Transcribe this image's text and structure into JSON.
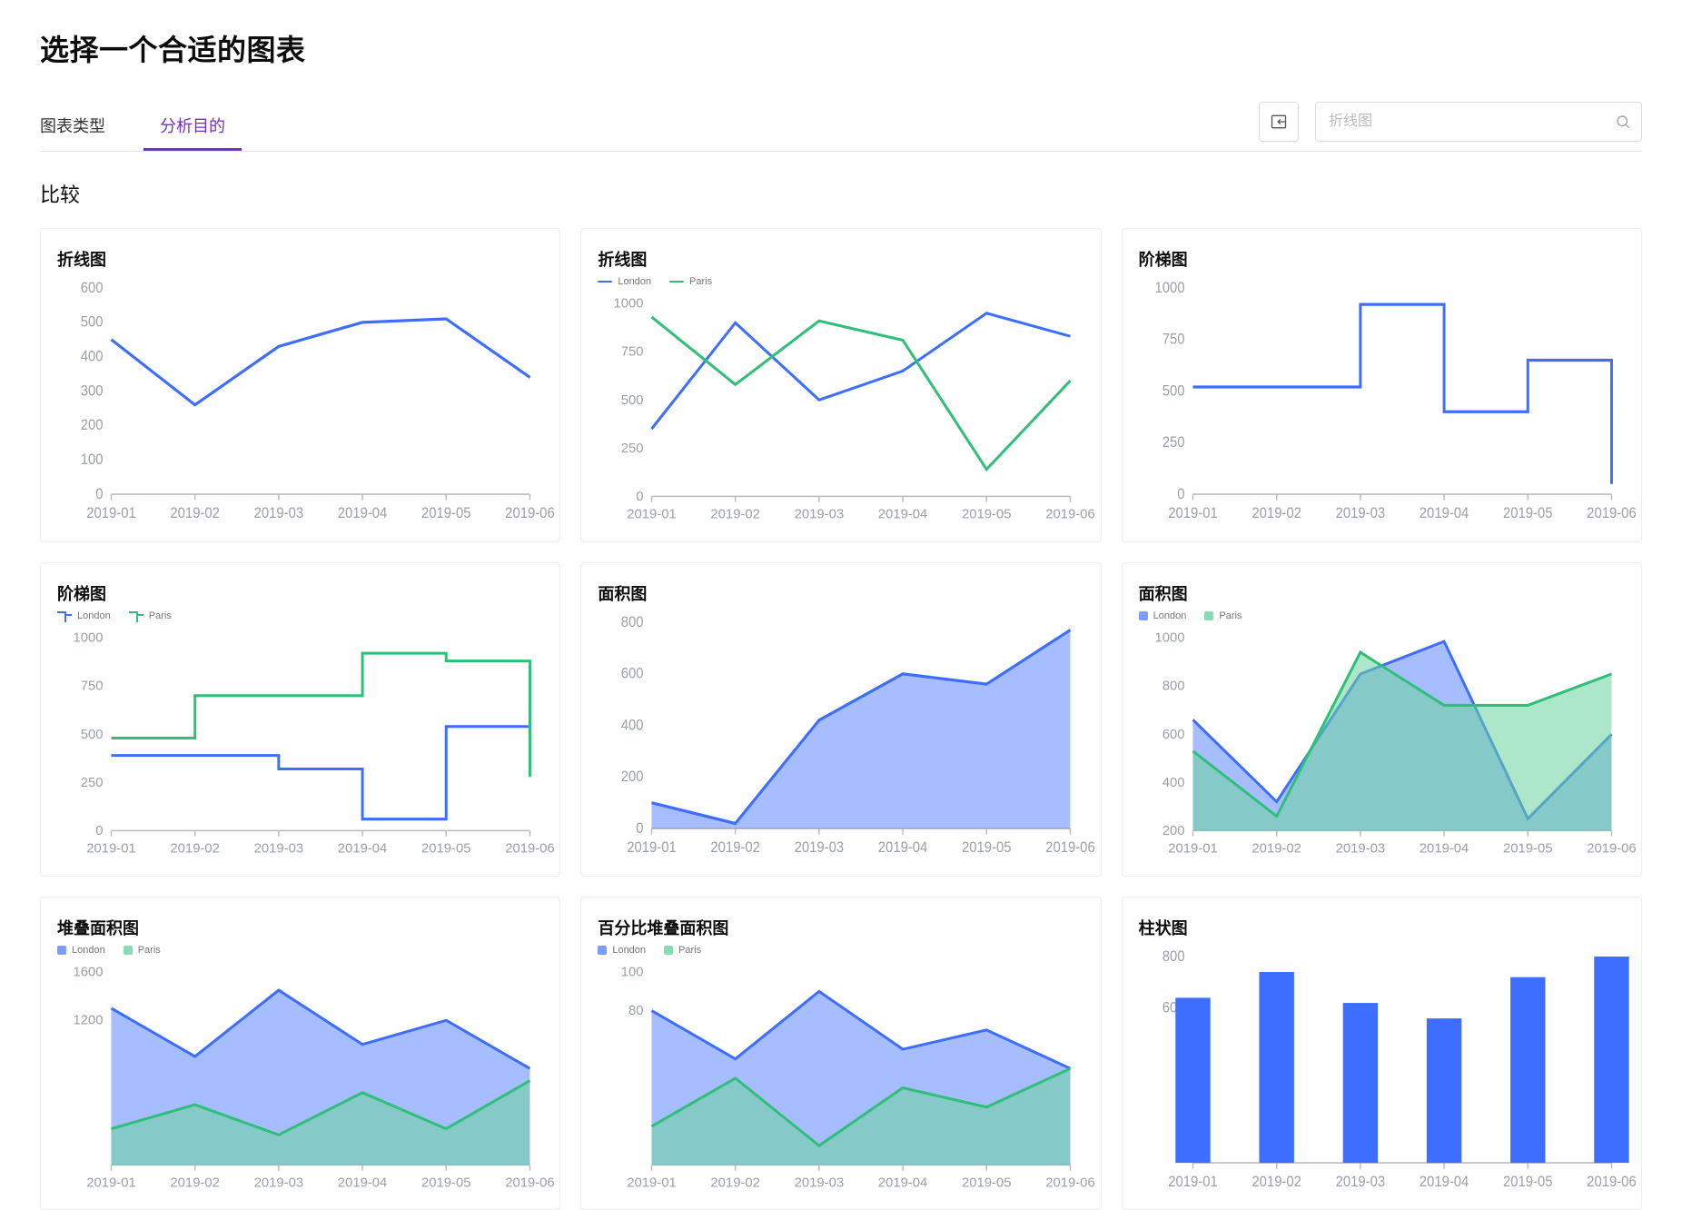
{
  "page": {
    "title": "选择一个合适的图表"
  },
  "toolbar": {
    "tabs": [
      {
        "label": "图表类型",
        "active": false
      },
      {
        "label": "分析目的",
        "active": true
      }
    ],
    "search_placeholder": "折线图"
  },
  "section": {
    "title": "比较"
  },
  "colors": {
    "blue": "#3d6eff",
    "green": "#30bf78",
    "blueFill": "rgba(93,134,255,0.55)",
    "greenFill": "rgba(106,211,157,0.55)"
  },
  "legend_labels": {
    "london": "London",
    "paris": "Paris"
  },
  "cards": [
    {
      "id": "line1",
      "title": "折线图"
    },
    {
      "id": "line2",
      "title": "折线图"
    },
    {
      "id": "step1",
      "title": "阶梯图"
    },
    {
      "id": "step2",
      "title": "阶梯图"
    },
    {
      "id": "area1",
      "title": "面积图"
    },
    {
      "id": "area2",
      "title": "面积图"
    },
    {
      "id": "stack1",
      "title": "堆叠面积图"
    },
    {
      "id": "pct1",
      "title": "百分比堆叠面积图"
    },
    {
      "id": "bar1",
      "title": "柱状图"
    }
  ],
  "chart_data": [
    {
      "id": "line1",
      "type": "line",
      "title": "折线图",
      "categories": [
        "2019-01",
        "2019-02",
        "2019-03",
        "2019-04",
        "2019-05",
        "2019-06"
      ],
      "series": [
        {
          "name": "",
          "values": [
            450,
            260,
            430,
            500,
            510,
            340
          ]
        }
      ],
      "ylim": [
        0,
        600
      ],
      "yticks": [
        0,
        100,
        200,
        300,
        400,
        500,
        600
      ]
    },
    {
      "id": "line2",
      "type": "line",
      "title": "折线图",
      "categories": [
        "2019-01",
        "2019-02",
        "2019-03",
        "2019-04",
        "2019-05",
        "2019-06"
      ],
      "series": [
        {
          "name": "London",
          "values": [
            350,
            900,
            500,
            650,
            950,
            830
          ]
        },
        {
          "name": "Paris",
          "values": [
            930,
            580,
            910,
            810,
            140,
            600
          ]
        }
      ],
      "ylim": [
        0,
        1000
      ],
      "yticks": [
        0,
        250,
        500,
        750,
        1000
      ]
    },
    {
      "id": "step1",
      "type": "step",
      "title": "阶梯图",
      "categories": [
        "2019-01",
        "2019-02",
        "2019-03",
        "2019-04",
        "2019-05",
        "2019-06"
      ],
      "series": [
        {
          "name": "",
          "values": [
            520,
            520,
            920,
            400,
            650,
            50
          ]
        }
      ],
      "ylim": [
        0,
        1000
      ],
      "yticks": [
        0,
        250,
        500,
        750,
        1000
      ]
    },
    {
      "id": "step2",
      "type": "step",
      "title": "阶梯图",
      "categories": [
        "2019-01",
        "2019-02",
        "2019-03",
        "2019-04",
        "2019-05",
        "2019-06"
      ],
      "series": [
        {
          "name": "London",
          "values": [
            390,
            390,
            320,
            60,
            540,
            650
          ]
        },
        {
          "name": "Paris",
          "values": [
            480,
            700,
            700,
            920,
            880,
            280
          ]
        }
      ],
      "ylim": [
        0,
        1000
      ],
      "yticks": [
        0,
        250,
        500,
        750,
        1000
      ]
    },
    {
      "id": "area1",
      "type": "area",
      "title": "面积图",
      "categories": [
        "2019-01",
        "2019-02",
        "2019-03",
        "2019-04",
        "2019-05",
        "2019-06"
      ],
      "series": [
        {
          "name": "",
          "values": [
            100,
            20,
            420,
            600,
            560,
            770
          ]
        }
      ],
      "ylim": [
        0,
        800
      ],
      "yticks": [
        0,
        200,
        400,
        600,
        800
      ]
    },
    {
      "id": "area2",
      "type": "area",
      "title": "面积图",
      "categories": [
        "2019-01",
        "2019-02",
        "2019-03",
        "2019-04",
        "2019-05",
        "2019-06"
      ],
      "series": [
        {
          "name": "London",
          "values": [
            660,
            320,
            850,
            985,
            250,
            600
          ]
        },
        {
          "name": "Paris",
          "values": [
            530,
            260,
            940,
            720,
            720,
            850
          ]
        }
      ],
      "ylim": [
        200,
        1000
      ],
      "yticks": [
        200,
        400,
        600,
        800,
        1000
      ]
    },
    {
      "id": "stack1",
      "type": "area",
      "title": "堆叠面积图",
      "categories": [
        "2019-01",
        "2019-02",
        "2019-03",
        "2019-04",
        "2019-05",
        "2019-06"
      ],
      "series": [
        {
          "name": "London",
          "values": [
            1300,
            900,
            1450,
            1000,
            1200,
            800
          ]
        },
        {
          "name": "Paris",
          "values": [
            300,
            500,
            250,
            600,
            300,
            700
          ]
        }
      ],
      "ylim": [
        0,
        1600
      ],
      "yticks": [
        1200,
        1600
      ]
    },
    {
      "id": "pct1",
      "type": "area",
      "title": "百分比堆叠面积图",
      "categories": [
        "2019-01",
        "2019-02",
        "2019-03",
        "2019-04",
        "2019-05",
        "2019-06"
      ],
      "series": [
        {
          "name": "London",
          "values": [
            80,
            55,
            90,
            60,
            70,
            50
          ]
        },
        {
          "name": "Paris",
          "values": [
            20,
            45,
            10,
            40,
            30,
            50
          ]
        }
      ],
      "ylim": [
        0,
        100
      ],
      "yticks": [
        80,
        100
      ]
    },
    {
      "id": "bar1",
      "type": "bar",
      "title": "柱状图",
      "categories": [
        "2019-01",
        "2019-02",
        "2019-03",
        "2019-04",
        "2019-05",
        "2019-06"
      ],
      "series": [
        {
          "name": "",
          "values": [
            640,
            740,
            620,
            560,
            720,
            800
          ]
        }
      ],
      "ylim": [
        0,
        800
      ],
      "yticks": [
        600,
        800
      ]
    }
  ]
}
